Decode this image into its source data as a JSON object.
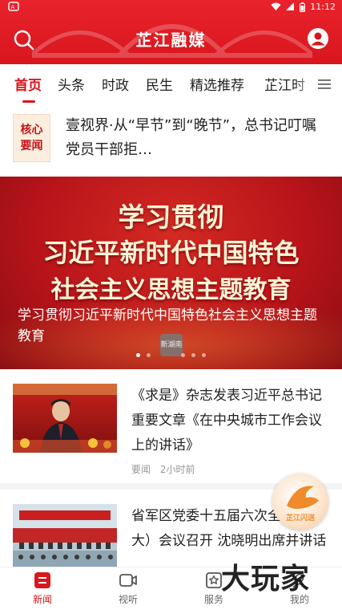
{
  "status_bar": {
    "time": "11:12"
  },
  "header": {
    "title": "芷江融媒",
    "accent": "#d9151d"
  },
  "tabs": [
    {
      "label": "首页",
      "active": true
    },
    {
      "label": "头条"
    },
    {
      "label": "时政"
    },
    {
      "label": "民生"
    },
    {
      "label": "精选推荐"
    },
    {
      "label": "芷江时"
    }
  ],
  "headline": {
    "badge": [
      "核心",
      "要闻"
    ],
    "text": "壹视界·从“早节”到“晚节”，总书记叮嘱党员干部拒…"
  },
  "banner": {
    "lines": [
      "学习贯彻",
      "习近平新时代中国特色",
      "社会主义思想主题教育"
    ],
    "caption": "学习贯彻习近平新时代中国特色社会主义思想主题教育",
    "seal": "新湖南",
    "dots": 5,
    "active_dot": 0
  },
  "news": [
    {
      "title": "《求是》杂志发表习近平总书记重要文章《在中央城市工作会议上的讲话》",
      "source": "要闻",
      "time": "2小时前"
    },
    {
      "title": "省军区党委十五届六次全体（扩大）会议召开 沈晓明出席并讲话",
      "source": "",
      "time": ""
    }
  ],
  "floating_widget": {
    "label": "芷江闪送"
  },
  "bottom_nav": [
    {
      "label": "新闻",
      "icon": "news-icon",
      "active": true
    },
    {
      "label": "视听",
      "icon": "video-icon"
    },
    {
      "label": "服务",
      "icon": "service-icon"
    },
    {
      "label": "我的",
      "icon": "profile-icon"
    }
  ],
  "watermark": "大玩家"
}
